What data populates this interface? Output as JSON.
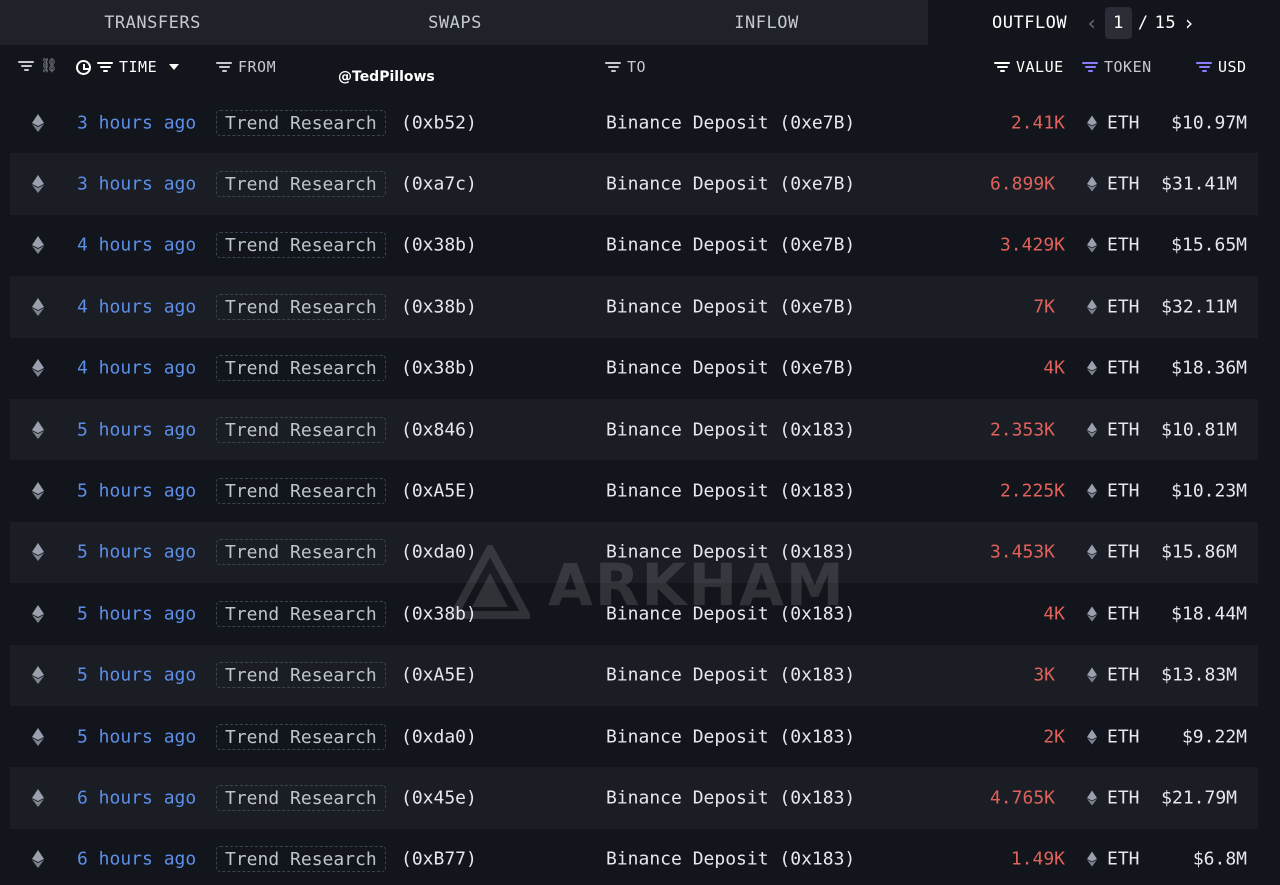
{
  "tabs": [
    {
      "label": "TRANSFERS"
    },
    {
      "label": "SWAPS"
    },
    {
      "label": "INFLOW"
    },
    {
      "label": "OUTFLOW"
    }
  ],
  "pager": {
    "current": "1",
    "separator": "/",
    "total": "15"
  },
  "header": {
    "time": "TIME",
    "from": "FROM",
    "to": "TO",
    "value": "VALUE",
    "token": "TOKEN",
    "usd": "USD",
    "handle": "@TedPillows"
  },
  "rows": [
    {
      "time": "3 hours ago",
      "from_label": "Trend Research",
      "from_addr": "(0xb52)",
      "to": "Binance Deposit (0xe7B)",
      "value": "2.41K",
      "token": "ETH",
      "usd": "$10.97M"
    },
    {
      "time": "3 hours ago",
      "from_label": "Trend Research",
      "from_addr": "(0xa7c)",
      "to": "Binance Deposit (0xe7B)",
      "value": "6.899K",
      "token": "ETH",
      "usd": "$31.41M"
    },
    {
      "time": "4 hours ago",
      "from_label": "Trend Research",
      "from_addr": "(0x38b)",
      "to": "Binance Deposit (0xe7B)",
      "value": "3.429K",
      "token": "ETH",
      "usd": "$15.65M"
    },
    {
      "time": "4 hours ago",
      "from_label": "Trend Research",
      "from_addr": "(0x38b)",
      "to": "Binance Deposit (0xe7B)",
      "value": "7K",
      "token": "ETH",
      "usd": "$32.11M"
    },
    {
      "time": "4 hours ago",
      "from_label": "Trend Research",
      "from_addr": "(0x38b)",
      "to": "Binance Deposit (0xe7B)",
      "value": "4K",
      "token": "ETH",
      "usd": "$18.36M"
    },
    {
      "time": "5 hours ago",
      "from_label": "Trend Research",
      "from_addr": "(0x846)",
      "to": "Binance Deposit (0x183)",
      "value": "2.353K",
      "token": "ETH",
      "usd": "$10.81M"
    },
    {
      "time": "5 hours ago",
      "from_label": "Trend Research",
      "from_addr": "(0xA5E)",
      "to": "Binance Deposit (0x183)",
      "value": "2.225K",
      "token": "ETH",
      "usd": "$10.23M"
    },
    {
      "time": "5 hours ago",
      "from_label": "Trend Research",
      "from_addr": "(0xda0)",
      "to": "Binance Deposit (0x183)",
      "value": "3.453K",
      "token": "ETH",
      "usd": "$15.86M"
    },
    {
      "time": "5 hours ago",
      "from_label": "Trend Research",
      "from_addr": "(0x38b)",
      "to": "Binance Deposit (0x183)",
      "value": "4K",
      "token": "ETH",
      "usd": "$18.44M"
    },
    {
      "time": "5 hours ago",
      "from_label": "Trend Research",
      "from_addr": "(0xA5E)",
      "to": "Binance Deposit (0x183)",
      "value": "3K",
      "token": "ETH",
      "usd": "$13.83M"
    },
    {
      "time": "5 hours ago",
      "from_label": "Trend Research",
      "from_addr": "(0xda0)",
      "to": "Binance Deposit (0x183)",
      "value": "2K",
      "token": "ETH",
      "usd": "$9.22M"
    },
    {
      "time": "6 hours ago",
      "from_label": "Trend Research",
      "from_addr": "(0x45e)",
      "to": "Binance Deposit (0x183)",
      "value": "4.765K",
      "token": "ETH",
      "usd": "$21.79M"
    },
    {
      "time": "6 hours ago",
      "from_label": "Trend Research",
      "from_addr": "(0xB77)",
      "to": "Binance Deposit (0x183)",
      "value": "1.49K",
      "token": "ETH",
      "usd": "$6.8M"
    }
  ],
  "watermark": {
    "text": "ARKHAM"
  },
  "colors": {
    "accent_time": "#5c8fe8",
    "value_out": "#e0625a",
    "filter_purple": "#8b7dff",
    "background": "#13151c"
  },
  "icons": {
    "chain": "ethereum-icon",
    "filter": "filter-icon",
    "link": "link-icon",
    "clock": "clock-icon"
  }
}
